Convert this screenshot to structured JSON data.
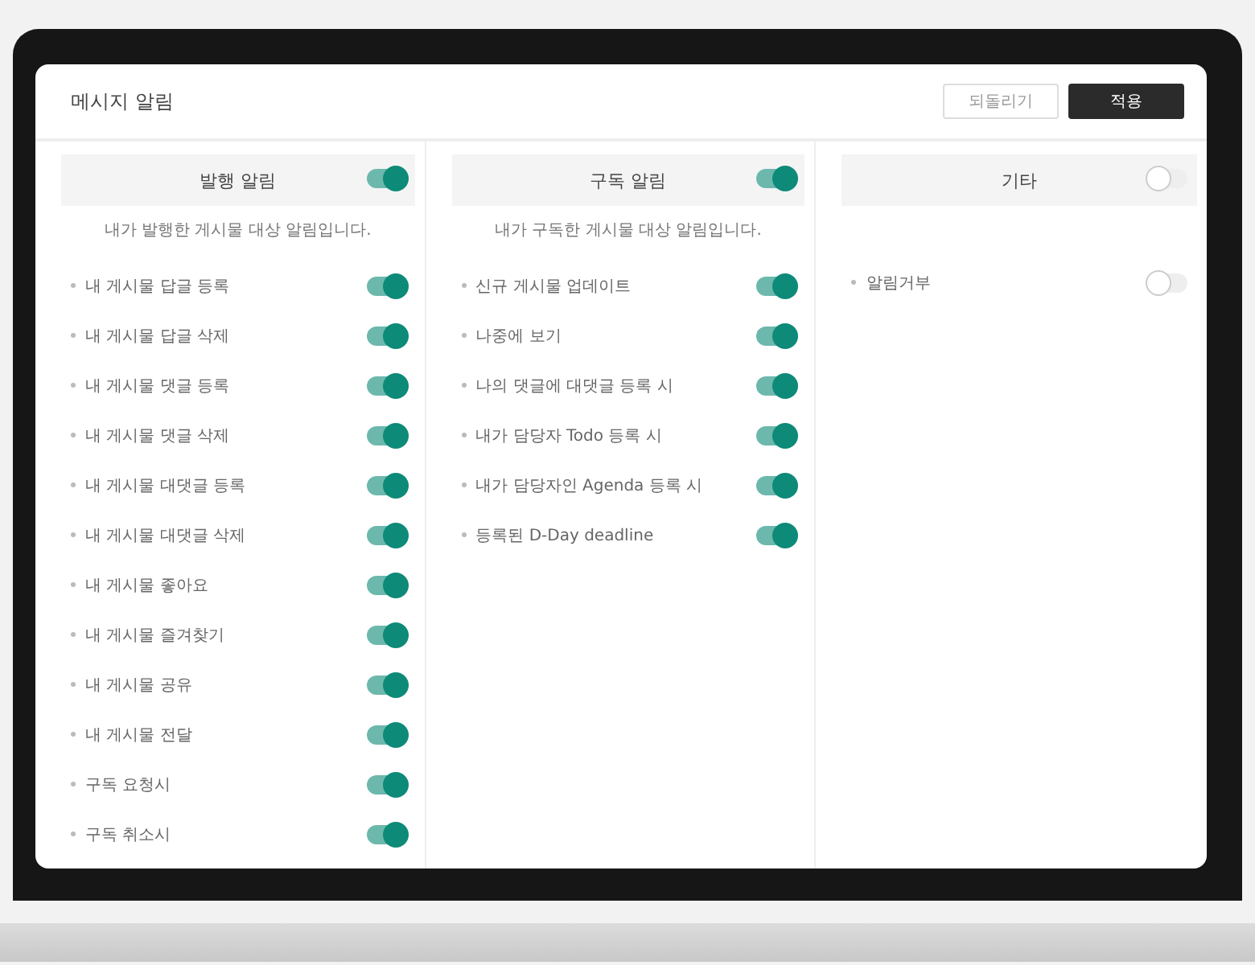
{
  "window": {
    "title": "메시지 알림"
  },
  "buttons": [
    {
      "label": "되돌리기",
      "kind": "secondary"
    },
    {
      "label": "적용",
      "kind": "primary"
    }
  ],
  "columns": [
    {
      "title": "발행 알림",
      "on": true,
      "description": "내가 발행한 게시물 대상 알림입니다.",
      "items": [
        {
          "label": "내 게시물 답글 등록",
          "on": true
        },
        {
          "label": "내 게시물 답글 삭제",
          "on": true
        },
        {
          "label": "내 게시물 댓글 등록",
          "on": true
        },
        {
          "label": "내 게시물 댓글 삭제",
          "on": true
        },
        {
          "label": "내 게시물 대댓글 등록",
          "on": true
        },
        {
          "label": "내 게시물 대댓글 삭제",
          "on": true
        },
        {
          "label": "내 게시물 좋아요",
          "on": true
        },
        {
          "label": "내 게시물 즐겨찾기",
          "on": true
        },
        {
          "label": "내 게시물 공유",
          "on": true
        },
        {
          "label": "내 게시물 전달",
          "on": true
        },
        {
          "label": "구독 요청시",
          "on": true
        },
        {
          "label": "구독 취소시",
          "on": true
        }
      ]
    },
    {
      "title": "구독 알림",
      "on": true,
      "description": "내가 구독한 게시물 대상 알림입니다.",
      "items": [
        {
          "label": "신규 게시물 업데이트",
          "on": true
        },
        {
          "label": "나중에 보기",
          "on": true
        },
        {
          "label": "나의 댓글에 대댓글 등록 시",
          "on": true
        },
        {
          "label": "내가 담당자 Todo 등록 시",
          "on": true
        },
        {
          "label": "내가 담당자인 Agenda 등록 시",
          "on": true
        },
        {
          "label": "등록된 D-Day deadline",
          "on": true
        }
      ]
    },
    {
      "title": "기타",
      "on": false,
      "items": [
        {
          "label": "알림거부",
          "on": false
        }
      ]
    }
  ]
}
